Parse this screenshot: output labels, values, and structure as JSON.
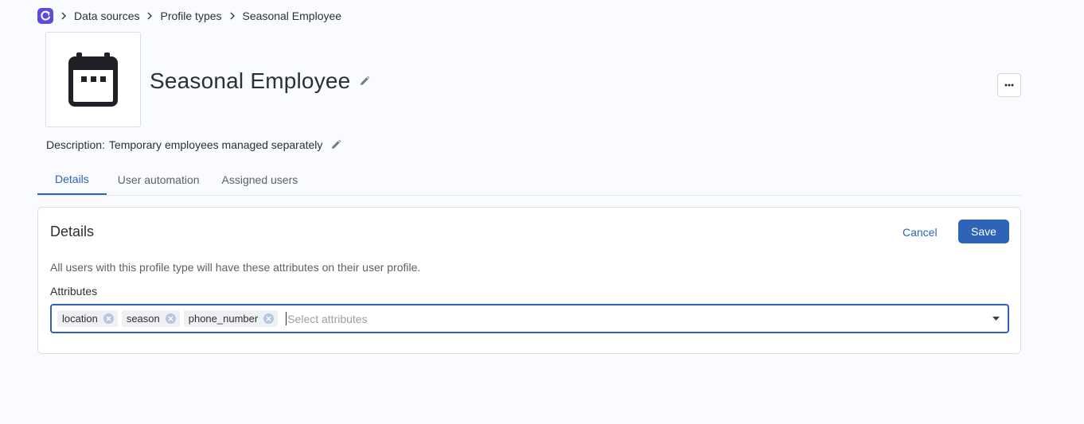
{
  "breadcrumb": {
    "items": [
      "Data sources",
      "Profile types",
      "Seasonal Employee"
    ]
  },
  "header": {
    "title": "Seasonal Employee",
    "icon": "calendar-icon",
    "more_icon": "ellipsis-icon"
  },
  "description": {
    "label": "Description:",
    "value": "Temporary employees managed separately"
  },
  "tabs": [
    {
      "label": "Details",
      "active": true
    },
    {
      "label": "User automation",
      "active": false
    },
    {
      "label": "Assigned users",
      "active": false
    }
  ],
  "details": {
    "title": "Details",
    "cancel_label": "Cancel",
    "save_label": "Save",
    "help_text": "All users with this profile type will have these attributes on their user profile.",
    "attributes_label": "Attributes",
    "attributes": [
      "location",
      "season",
      "phone_number"
    ],
    "placeholder": "Select attributes"
  },
  "colors": {
    "accent": "#2f63b8",
    "logo": "#5b4cdb"
  }
}
